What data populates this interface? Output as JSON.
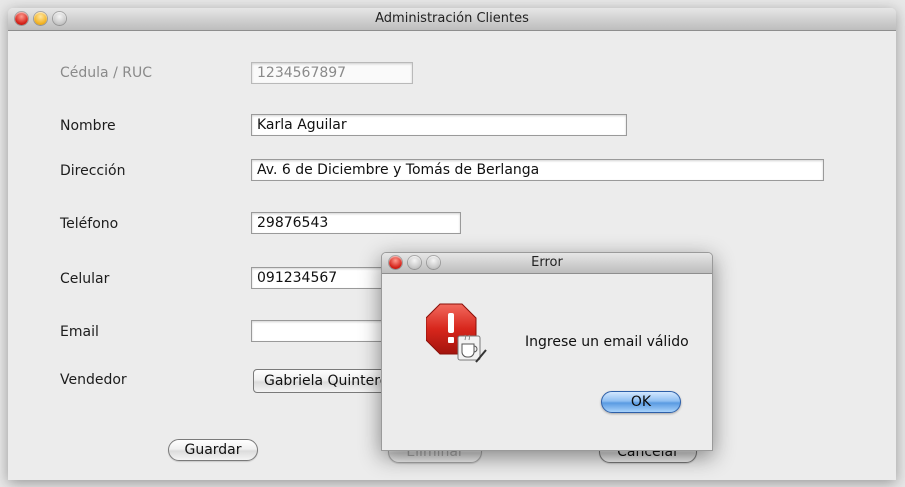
{
  "window": {
    "title": "Administración Clientes"
  },
  "form": {
    "cedula": {
      "label": "Cédula / RUC",
      "value": "1234567897"
    },
    "nombre": {
      "label": "Nombre",
      "value": "Karla Aguilar"
    },
    "direccion": {
      "label": "Dirección",
      "value": "Av. 6 de Diciembre y Tomás de Berlanga"
    },
    "telefono": {
      "label": "Teléfono",
      "value": "29876543"
    },
    "celular": {
      "label": "Celular",
      "value": "091234567"
    },
    "email": {
      "label": "Email",
      "value": ""
    },
    "vendedor": {
      "label": "Vendedor",
      "value": "Gabriela Quintero"
    }
  },
  "buttons": {
    "guardar": "Guardar",
    "eliminar": "Eliminar",
    "cancelar": "Cancelar"
  },
  "dialog": {
    "title": "Error",
    "message": "Ingrese un email válido",
    "ok": "OK"
  },
  "colors": {
    "dialog_ok_accent": "#5a9be2",
    "error_icon": "#d7261c"
  },
  "icons": {
    "dialog_icon": "error-stop-sign-icon"
  }
}
